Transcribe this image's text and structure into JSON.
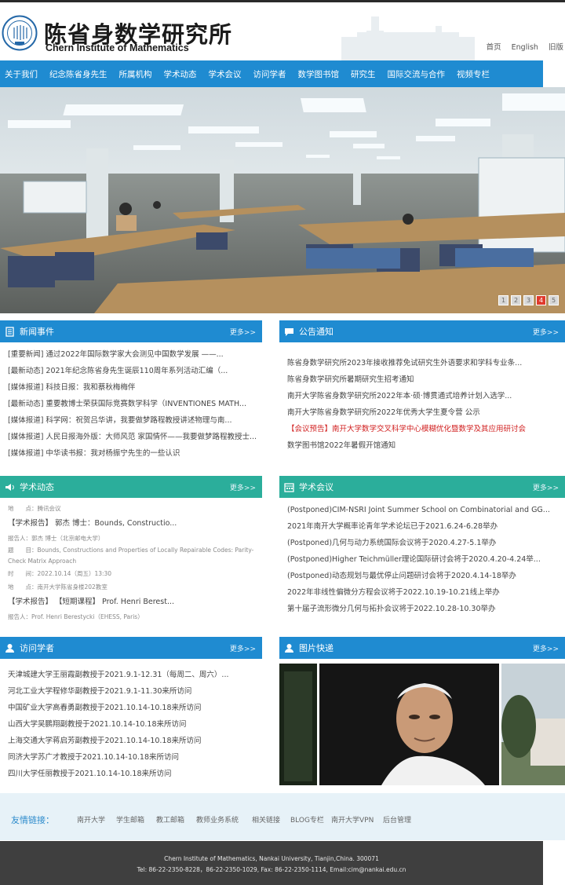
{
  "header": {
    "title_cn": "陈省身数学研究所",
    "title_en": "Chern Institute of Mathematics",
    "links": [
      "首页",
      "English",
      "旧版"
    ]
  },
  "nav": [
    "关于我们",
    "纪念陈省身先生",
    "所属机构",
    "学术动态",
    "学术会议",
    "访问学者",
    "数学图书馆",
    "研究生",
    "国际交流与合作",
    "视频专栏"
  ],
  "banner": {
    "pages": [
      "1",
      "2",
      "3",
      "4",
      "5"
    ],
    "active_page": "4"
  },
  "more_label": "更多>>",
  "news": {
    "title": "新闻事件",
    "items": [
      "[重要新闻] 通过2022年国际数学家大会测见中国数学发展 ——...",
      "[最新动态] 2021年纪念陈省身先生诞辰110周年系列活动汇编（...",
      "[媒体报道] 科技日报：我和蔡秋梅梅伴",
      "[最新动态] 重要教博士荣获国际竞赛数学科学（INVENTIONES MATH...",
      "[媒体报道] 科学网：祝贺吕华讲，我要做梦路程教授讲述物理与南...",
      "[媒体报道] 人民日报海外版：大师风范 家国情怀——我要做梦路程教授士...",
      "[媒体报道] 中华读书报：我对杨振宁先生的一些认识"
    ]
  },
  "notice": {
    "title": "公告通知",
    "items": [
      "陈省身数学研究所2023年接收推荐免试研究生外语要求和学科专业条...",
      "陈省身数学研究所暑期研究生招考通知",
      "南开大学陈省身数学研究所2022年本·硕·博贯通式培养计划入选学...",
      "南开大学陈省身数学研究所2022年优秀大学生夏令营 公示",
      "【会议预告】南开大学数学交叉科学中心模糊优化暨数学及其应用研讨会",
      "数学图书馆2022年暑假开馆通知"
    ]
  },
  "academic": {
    "title": "学术动态",
    "items": [
      "地　　点：腾讯会议",
      "【学术报告】 郭杰 博士：Bounds, Constructio...",
      "报告人：郭杰 博士（北京邮电大学）",
      "题　　目：Bounds, Constructions and Properties of Locally Repairable Codes: Parity-Check Matrix Approach",
      "时　　间：2022.10.14（周五）13:30",
      "地　　点：南开大学陈省身楼202教室",
      "【学术报告】 【短期课程】 Prof. Henri Berest...",
      "报告人：Prof. Henri Berestycki（EHESS, Paris）"
    ]
  },
  "conference": {
    "title": "学术会议",
    "items": [
      "(Postponed)CIM-NSRI Joint Summer School on Combinatorial and GG...",
      "2021年南开大学概率论青年学术论坛已于2021.6.24-6.28举办",
      "(Postponed)几何与动力系统国际会议将于2020.4.27-5.1举办",
      "(Postponed)Higher Teichmüller理论国际研讨会将于2020.4.20-4.24举...",
      "(Postponed)动态规划与最优停止问题研讨会将于2020.4.14-18举办",
      "2022年非线性偏微分方程会议将于2022.10.19-10.21线上举办",
      "第十届子流形微分几何与拓扑会议将于2022.10.28-10.30举办"
    ]
  },
  "visitors": {
    "title": "访问学者",
    "items": [
      "天津城建大学王丽霞副教授于2021.9.1-12.31（每周二、周六）...",
      "河北工业大学程修华副教授于2021.9.1-11.30来所访问",
      "中国矿业大学高春勇副教授于2021.10.14-10.18来所访问",
      "山西大学吴鹏翔副教授于2021.10.14-10.18来所访问",
      "上海交通大学蒋启芳副教授于2021.10.14-10.18来所访问",
      "同济大学苏广才教授于2021.10.14-10.18来所访问",
      "四川大学任丽教授于2021.10.14-10.18来所访问"
    ]
  },
  "gallery": {
    "title": "图片快递"
  },
  "friend_links": {
    "label": "友情链接：",
    "items": [
      "南开大学",
      "学生邮箱",
      "教工邮箱",
      "教师业务系统",
      "相关链接",
      "BLOG专栏",
      "南开大学VPN",
      "后台管理"
    ]
  },
  "footer": {
    "line1": "Chern Institute of Mathematics, Nankai University, Tianjin,China. 300071",
    "line2": "Tel: 86-22-2350-8228，86-22-2350-1029, Fax: 86-22-2350-1114, Email:cim@nankai.edu.cn"
  },
  "colors": {
    "nav": "#1f8bd1",
    "teal": "#2bae9b",
    "active_dot": "#e03a2d"
  }
}
